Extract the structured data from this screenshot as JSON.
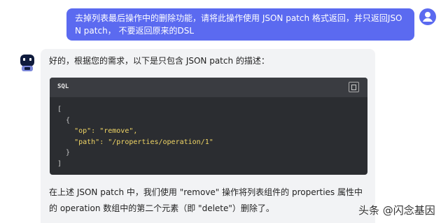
{
  "user_message": {
    "text": "去掉列表最后操作中的删除功能，请将此操作使用 JSON patch 格式返回，并只返回JSON patch， 不要返回原来的DSL"
  },
  "bot_message": {
    "intro": "好的，根据您的需求，以下是只包含 JSON patch 的描述：",
    "code": {
      "language": "SQL",
      "copy_icon": "copy-icon",
      "lines": [
        "[",
        "  {",
        "    \"op\": \"remove\",",
        "    \"path\": \"/properties/operation/1\"",
        "  }",
        "]"
      ]
    },
    "explanation": "在上述 JSON patch 中，我们使用 \"remove\" 操作将列表组件的 properties 属性中的 operation 数组中的第二个元素（即 \"delete\"）删除了。"
  },
  "watermark": "头条 @闪念基因",
  "colors": {
    "user_bubble": "#5b6af0",
    "bot_bubble": "#f2f3f5",
    "code_bg": "#2b2d31",
    "code_string": "#f0d565"
  }
}
